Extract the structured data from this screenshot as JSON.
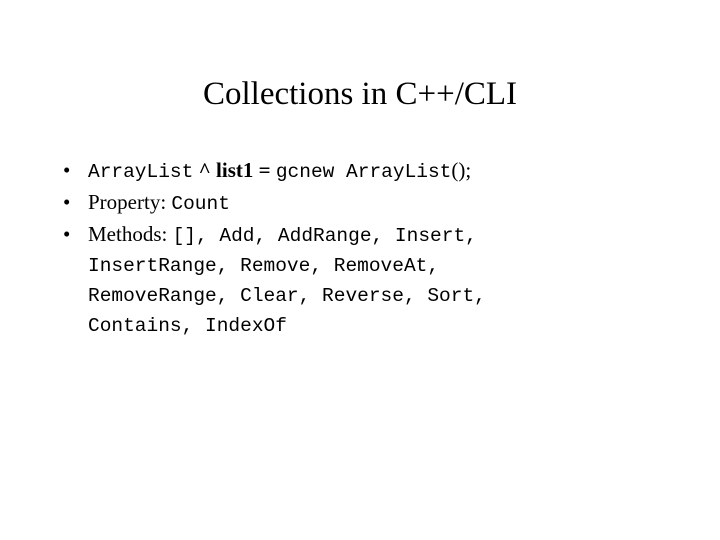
{
  "slide": {
    "title": "Collections in C++/CLI",
    "background_color": "#ffffff",
    "text_color": "#000000",
    "bullet_glyph": "•",
    "bullets": [
      {
        "name": "declaration",
        "runs": [
          {
            "text": "ArrayList",
            "style": "mono"
          },
          {
            "text": " ^ list1 = ",
            "style": "serif"
          },
          {
            "text": "gcnew ArrayList",
            "style": "mono"
          },
          {
            "text": "();",
            "style": "serif"
          }
        ],
        "plain": "ArrayList ^ list1 = gcnew ArrayList();"
      },
      {
        "name": "property",
        "runs": [
          {
            "text": "Property: ",
            "style": "serif"
          },
          {
            "text": "Count",
            "style": "mono"
          }
        ],
        "plain": "Property: Count"
      },
      {
        "name": "methods",
        "runs": [
          {
            "text": "Methods: ",
            "style": "serif"
          },
          {
            "text": "[], Add, AddRange, Insert,",
            "style": "mono"
          }
        ],
        "plain": "Methods: [], Add, AddRange, Insert,",
        "label": "Methods: ",
        "method_lines": [
          "[], Add, AddRange, Insert,",
          "InsertRange, Remove, RemoveAt,",
          "RemoveRange, Clear, Reverse, Sort,",
          "Contains, IndexOf"
        ]
      }
    ]
  }
}
